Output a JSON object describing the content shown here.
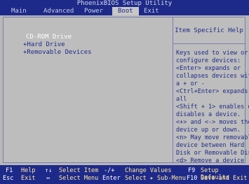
{
  "title": "PhoenixBIOS Setup Utility",
  "menu": [
    {
      "label": "Main"
    },
    {
      "label": "Advanced"
    },
    {
      "label": "Power"
    },
    {
      "label": "Boot",
      "active": true
    },
    {
      "label": "Exit"
    }
  ],
  "boot_items": [
    {
      "label": "CD-ROM Drive",
      "selected": true
    },
    {
      "label": "+Hard Drive"
    },
    {
      "label": "+Removable Devices"
    }
  ],
  "help": {
    "title": "Item Specific Help",
    "text": "Keys used to view or\nconfigure devices:\n<Enter> expands or\ncollapses devices with\na + or -\n<Ctrl+Enter> expands\nall\n<Shift + 1> enables or\ndisables a device.\n<+> and <-> moves the\ndevice up or down.\n<n> May move removable\ndevice between Hard\nDisk or Removable Disk\n<d> Remove a device\nthat is not installed."
  },
  "status": {
    "row1": [
      {
        "key": "F1",
        "desc": "Help"
      },
      {
        "key": "↑↓",
        "desc": "Select Item"
      },
      {
        "key": "-/+",
        "desc": "Change Values"
      },
      {
        "key": "F9",
        "desc": "Setup Defaults"
      }
    ],
    "row2": [
      {
        "key": "Esc",
        "desc": "Exit"
      },
      {
        "key": "↔",
        "desc": "Select Menu"
      },
      {
        "key": "Enter",
        "desc": "Select ▸ Sub-Menu"
      },
      {
        "key": "F10",
        "desc": "Save and Exit"
      }
    ]
  },
  "colors": {
    "bios_blue": "#1e2a8a",
    "panel_gray": "#bdbdbd",
    "selected_text": "#ffffff",
    "status_desc": "#ffe89a"
  }
}
